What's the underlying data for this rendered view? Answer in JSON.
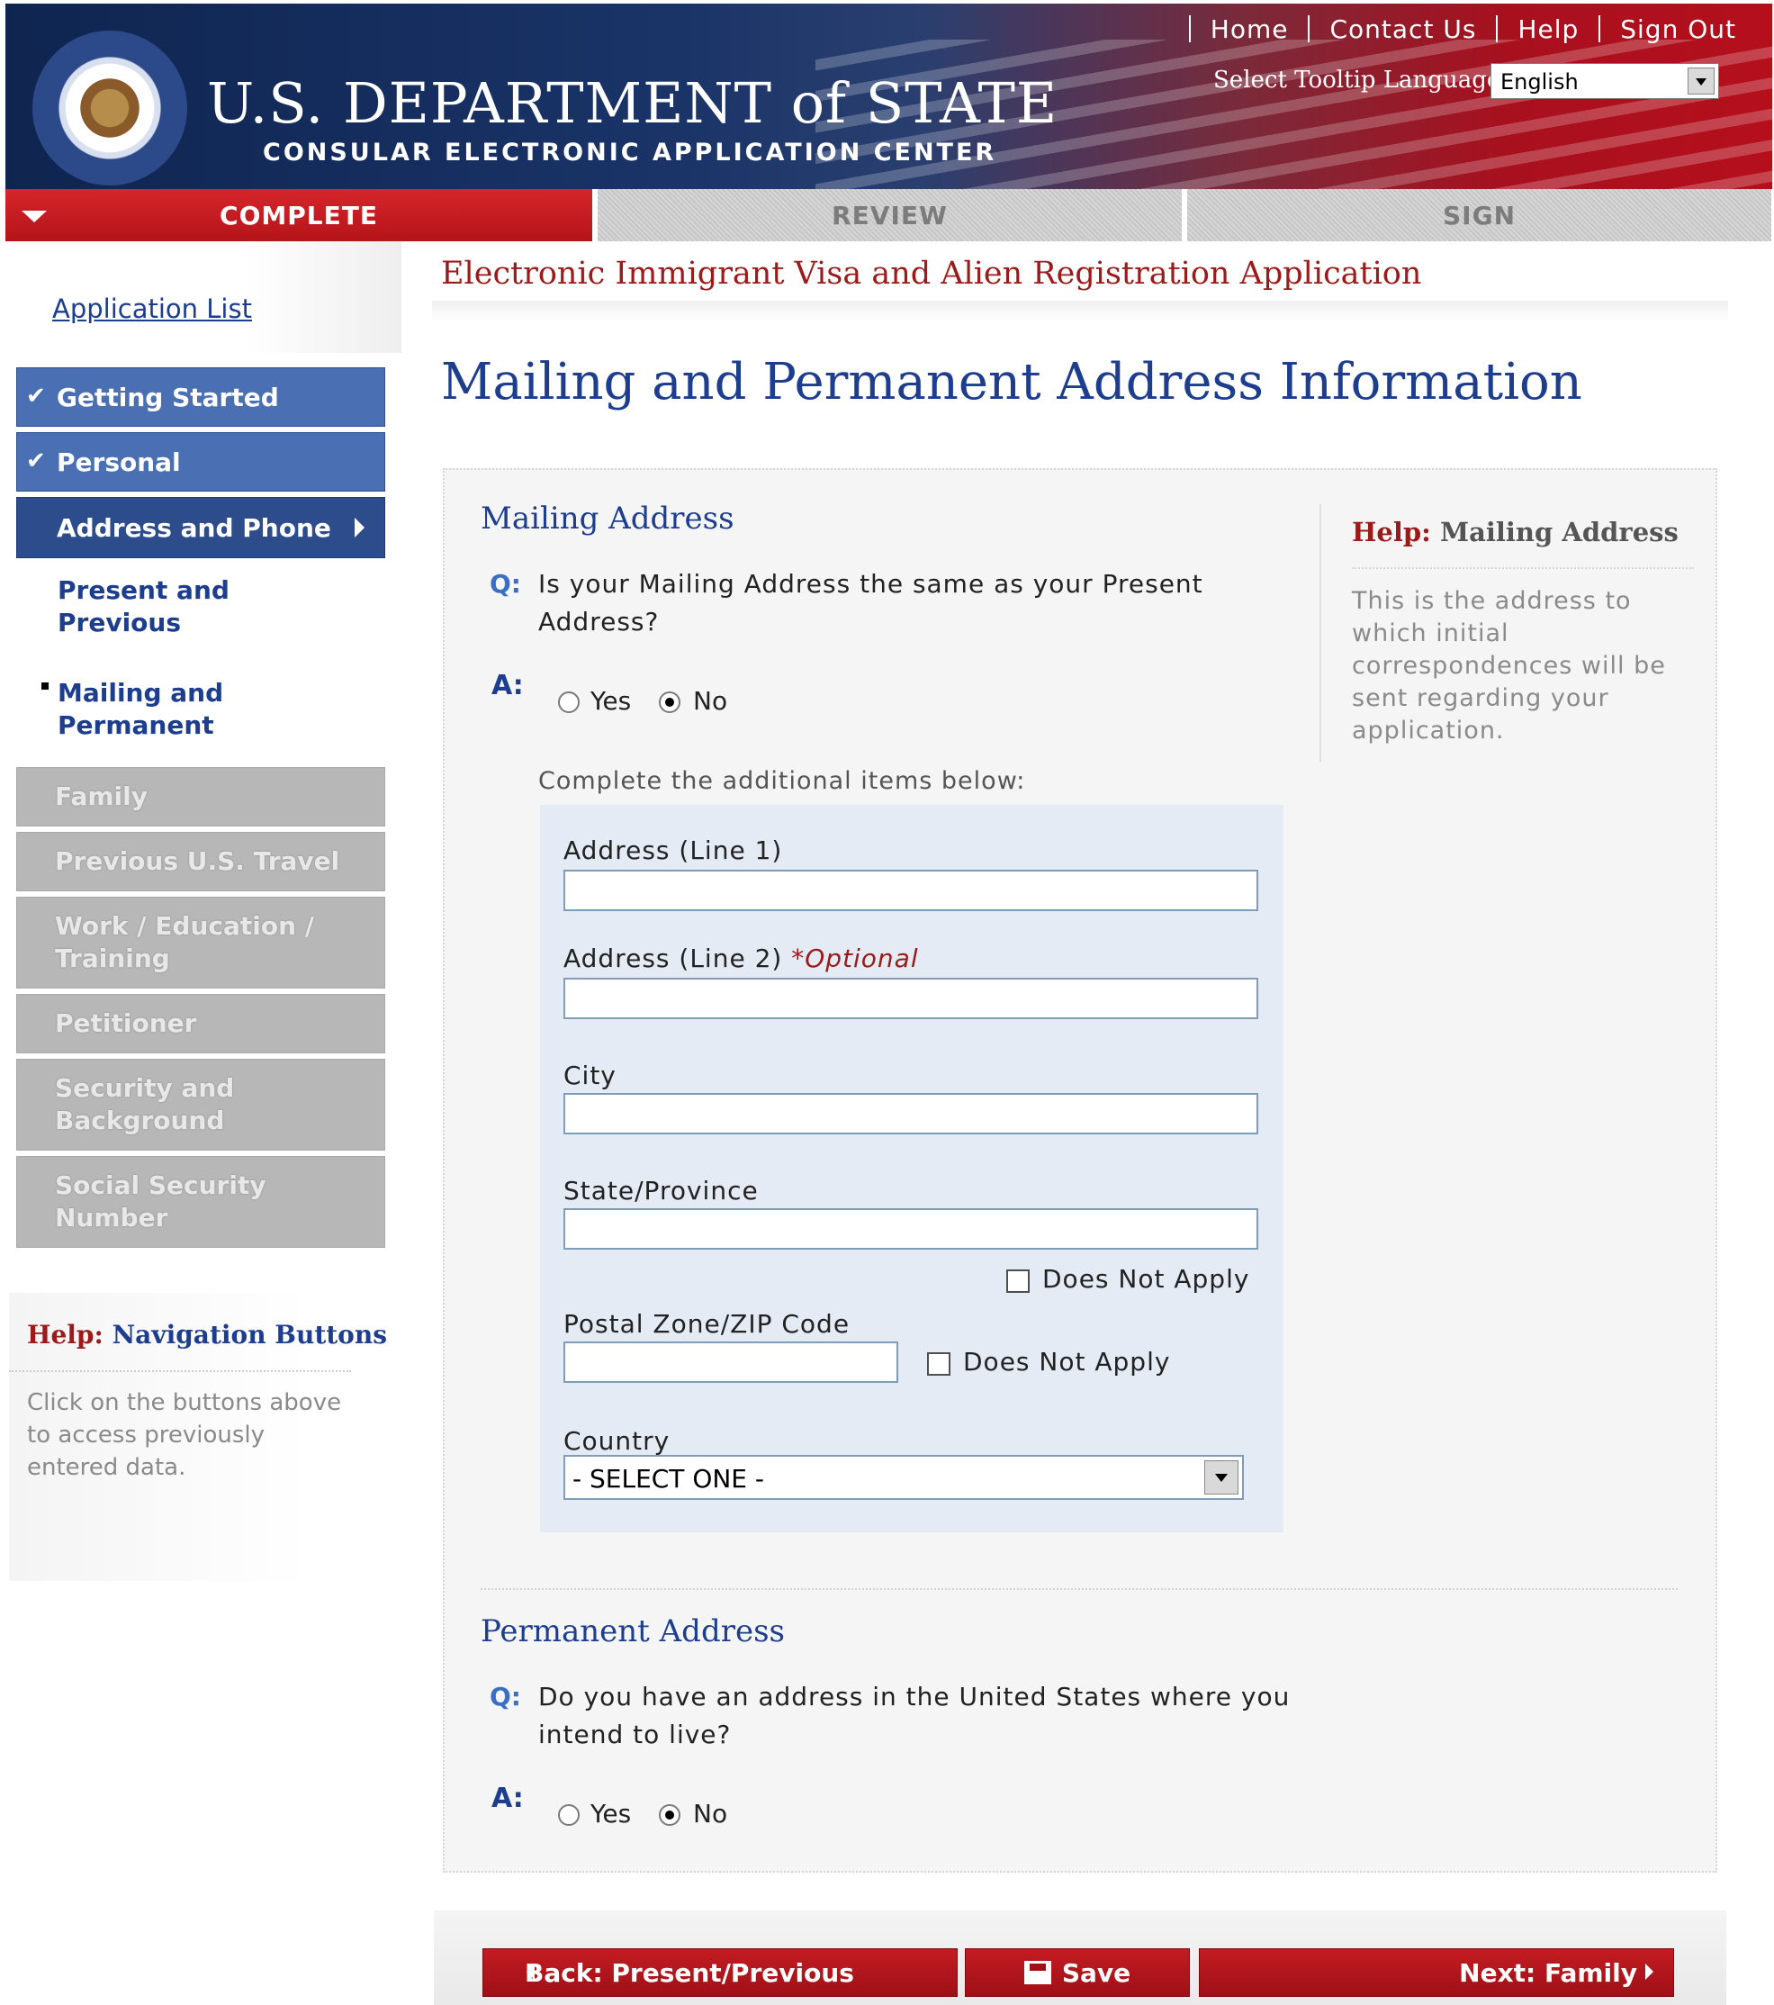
{
  "header": {
    "top_links": [
      "Home",
      "Contact Us",
      "Help",
      "Sign Out"
    ],
    "dept_title": "U.S. DEPARTMENT of STATE",
    "dept_subtitle": "CONSULAR ELECTRONIC APPLICATION CENTER",
    "tooltip_language_label": "Select Tooltip Language:",
    "tooltip_language_value": "English"
  },
  "tabs": {
    "complete": "COMPLETE",
    "review": "REVIEW",
    "sign": "SIGN"
  },
  "sidebar": {
    "application_list": "Application List",
    "items": [
      {
        "label": "Getting Started",
        "state": "done"
      },
      {
        "label": "Personal",
        "state": "done"
      },
      {
        "label": "Address and Phone",
        "state": "current"
      },
      {
        "label": "Present and Previous",
        "state": "sub"
      },
      {
        "label": "Mailing and Permanent",
        "state": "sub-active"
      },
      {
        "label": "Family",
        "state": "disabled"
      },
      {
        "label": "Previous U.S. Travel",
        "state": "disabled"
      },
      {
        "label": "Work / Education / Training",
        "state": "disabled"
      },
      {
        "label": "Petitioner",
        "state": "disabled"
      },
      {
        "label": "Security and Background",
        "state": "disabled"
      },
      {
        "label": "Social Security Number",
        "state": "disabled"
      }
    ],
    "help": {
      "prefix": "Help:",
      "title": "Navigation Buttons",
      "text": "Click on the buttons above to access previously entered data."
    }
  },
  "main": {
    "app_title": "Electronic Immigrant Visa and Alien Registration Application",
    "page_title": "Mailing and Permanent Address Information",
    "mailing": {
      "section_title": "Mailing Address",
      "q_marker": "Q:",
      "a_marker": "A:",
      "question": "Is your Mailing Address the same as your Present Address?",
      "yes_label": "Yes",
      "no_label": "No",
      "selected": "No",
      "complete_hint": "Complete the additional items below:",
      "fields": {
        "address1_label": "Address (Line 1)",
        "address1_value": "",
        "address2_label": "Address (Line 2)",
        "address2_optional": "*Optional",
        "address2_value": "",
        "city_label": "City",
        "city_value": "",
        "state_label": "State/Province",
        "state_value": "",
        "state_dna_label": "Does Not Apply",
        "zip_label": "Postal Zone/ZIP Code",
        "zip_value": "",
        "zip_dna_label": "Does Not Apply",
        "country_label": "Country",
        "country_value": "- SELECT ONE -"
      }
    },
    "help": {
      "prefix": "Help:",
      "title": "Mailing Address",
      "text": "This is the address to which initial correspondences will be sent regarding your application."
    },
    "permanent": {
      "section_title": "Permanent Address",
      "question": "Do you have an address in the United States where you intend to live?",
      "yes_label": "Yes",
      "no_label": "No",
      "selected": "No"
    }
  },
  "buttons": {
    "back": "Back: Present/Previous",
    "save": "Save",
    "next": "Next: Family"
  }
}
